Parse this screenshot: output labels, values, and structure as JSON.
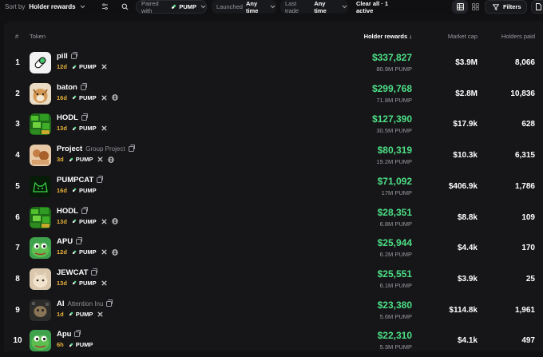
{
  "toolbar": {
    "sort_prefix": "Sort by",
    "sort_value": "Holder rewards",
    "paired_prefix": "Paired with",
    "paired_value": "PUMP",
    "launched_prefix": "Launched",
    "launched_value": "Any time",
    "lasttrade_prefix": "Last trade",
    "lasttrade_value": "Any time",
    "clear_label": "Clear all · 1 active",
    "filters_label": "Filters"
  },
  "columns": {
    "rank": "#",
    "token": "Token",
    "holder_rewards": "Holder rewards ↓",
    "market_cap": "Market cap",
    "holders_paid": "Holders paid"
  },
  "accent": "#4ddf86",
  "rows": [
    {
      "rank": "1",
      "name": "pill",
      "subtitle": "",
      "age": "12d",
      "pair": "PUMP",
      "socials": [
        "x"
      ],
      "reward": "$337,827",
      "reward_tokens": "80.9M PUMP",
      "market_cap": "$3.9M",
      "holders": "8,066",
      "avatar": "pill"
    },
    {
      "rank": "2",
      "name": "baton",
      "subtitle": "",
      "age": "16d",
      "pair": "PUMP",
      "socials": [
        "x",
        "web"
      ],
      "reward": "$299,768",
      "reward_tokens": "71.8M PUMP",
      "market_cap": "$2.8M",
      "holders": "10,836",
      "avatar": "dog"
    },
    {
      "rank": "3",
      "name": "HODL",
      "subtitle": "",
      "age": "13d",
      "pair": "PUMP",
      "socials": [
        "x"
      ],
      "reward": "$127,390",
      "reward_tokens": "30.5M PUMP",
      "market_cap": "$17.9k",
      "holders": "628",
      "avatar": "green"
    },
    {
      "rank": "4",
      "name": "Project",
      "subtitle": "Group Project",
      "age": "3d",
      "pair": "PUMP",
      "socials": [
        "x",
        "web"
      ],
      "reward": "$80,319",
      "reward_tokens": "19.2M PUMP",
      "market_cap": "$10.3k",
      "holders": "6,315",
      "avatar": "project"
    },
    {
      "rank": "5",
      "name": "PUMPCAT",
      "subtitle": "",
      "age": "16d",
      "pair": "PUMP",
      "socials": [],
      "reward": "$71,092",
      "reward_tokens": "17M PUMP",
      "market_cap": "$406.9k",
      "holders": "1,786",
      "avatar": "cat-green"
    },
    {
      "rank": "6",
      "name": "HODL",
      "subtitle": "",
      "age": "13d",
      "pair": "PUMP",
      "socials": [
        "x",
        "web"
      ],
      "reward": "$28,351",
      "reward_tokens": "6.8M PUMP",
      "market_cap": "$8.8k",
      "holders": "109",
      "avatar": "green"
    },
    {
      "rank": "7",
      "name": "APU",
      "subtitle": "",
      "age": "12d",
      "pair": "PUMP",
      "socials": [
        "x",
        "web"
      ],
      "reward": "$25,944",
      "reward_tokens": "6.2M PUMP",
      "market_cap": "$4.4k",
      "holders": "170",
      "avatar": "frog"
    },
    {
      "rank": "8",
      "name": "JEWCAT",
      "subtitle": "",
      "age": "13d",
      "pair": "PUMP",
      "socials": [
        "x"
      ],
      "reward": "$25,551",
      "reward_tokens": "6.1M PUMP",
      "market_cap": "$3.9k",
      "holders": "25",
      "avatar": "cat"
    },
    {
      "rank": "9",
      "name": "AI",
      "subtitle": "Attention Inu",
      "age": "1d",
      "pair": "PUMP",
      "socials": [
        "x"
      ],
      "reward": "$23,380",
      "reward_tokens": "5.6M PUMP",
      "market_cap": "$114.8k",
      "holders": "1,961",
      "avatar": "ai"
    },
    {
      "rank": "10",
      "name": "Apu",
      "subtitle": "",
      "age": "6h",
      "pair": "PUMP",
      "socials": [],
      "reward": "$22,310",
      "reward_tokens": "5.3M PUMP",
      "market_cap": "$4.1k",
      "holders": "497",
      "avatar": "frog"
    }
  ]
}
